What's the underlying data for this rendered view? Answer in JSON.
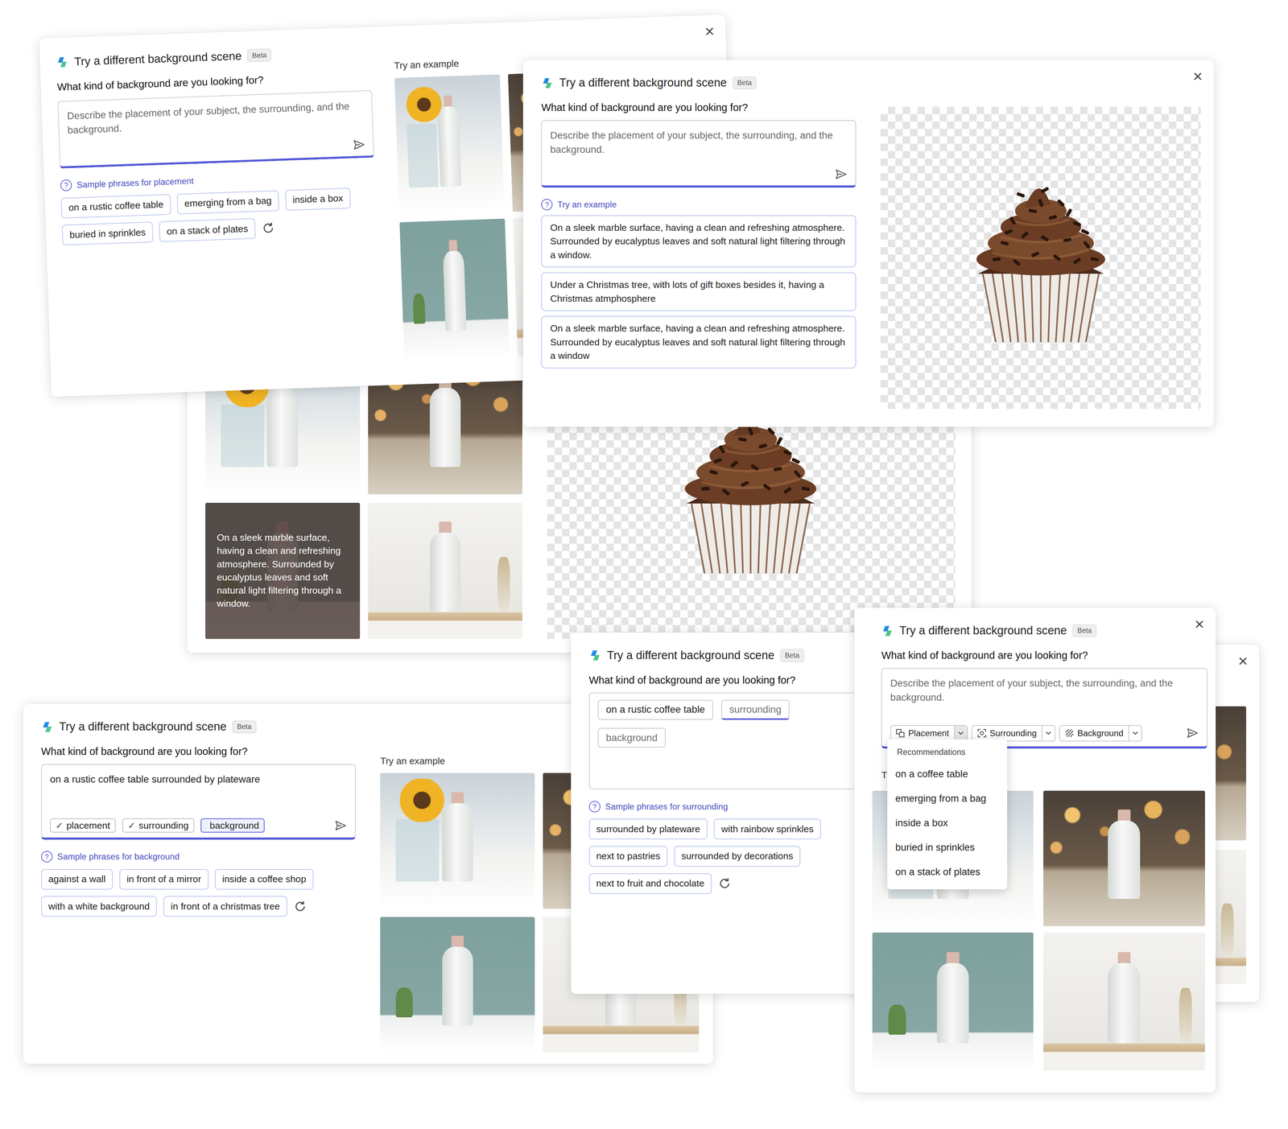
{
  "icons": {
    "close": "×",
    "help": "?",
    "check": "✓"
  },
  "placement_card": {
    "title": "Try a different background scene",
    "badge": "Beta",
    "question": "What kind of background are you looking for?",
    "placeholder": "Describe the placement of your subject, the surrounding, and the background.",
    "phrases_label": "Sample phrases for placement",
    "phrases": [
      "on a rustic coffee table",
      "emerging from a bag",
      "inside a box",
      "buried in sprinkles",
      "on a stack of plates"
    ],
    "examples_label": "Try an example"
  },
  "example_card": {
    "title": "Try a different background scene",
    "badge": "Beta",
    "question": "What kind of background are you looking for?",
    "placeholder": "Describe the placement of your subject, the surrounding, and the background.",
    "examples_label": "Try an example",
    "examples": [
      "On a sleek marble surface, having a clean and refreshing atmosphere. Surrounded by eucalyptus leaves and soft natural light filtering through a window.",
      "Under a Christmas tree, with lots of gift boxes besides it, having a Christmas atmphosphere",
      "On a sleek marble surface, having a clean and refreshing atmosphere. Surrounded by eucalyptus leaves and soft natural light filtering through a window"
    ]
  },
  "gallery_card": {
    "overlay": "On a sleek marble surface, having a clean and refreshing atmosphere. Surrounded by eucalyptus leaves and soft natural light filtering through a window."
  },
  "background_card": {
    "title": "Try a different background scene",
    "badge": "Beta",
    "question": "What kind of background are you looking for?",
    "value": "on a rustic coffee table surrounded by plateware",
    "tags": [
      {
        "label": "placement",
        "checked": true,
        "selected": false
      },
      {
        "label": "surrounding",
        "checked": true,
        "selected": false
      },
      {
        "label": "background",
        "checked": false,
        "selected": true
      }
    ],
    "phrases_label": "Sample phrases for background",
    "phrases": [
      "against a wall",
      "in front of a mirror",
      "inside a coffee shop",
      "with a white background",
      "in front of a christmas tree"
    ],
    "examples_label": "Try an example"
  },
  "surrounding_card": {
    "title": "Try a different background scene",
    "badge": "Beta",
    "question": "What kind of background are you looking for?",
    "slots": [
      {
        "label": "on a rustic coffee table",
        "kind": "filled",
        "selected": false
      },
      {
        "label": "surrounding",
        "kind": "empty",
        "selected": true
      },
      {
        "label": "background",
        "kind": "empty",
        "selected": false
      }
    ],
    "phrases_label": "Sample phrases for surrounding",
    "phrases": [
      "surrounded by plateware",
      "with rainbow sprinkles",
      "next to pastries",
      "surrounded by decorations",
      "next to fruit and chocolate"
    ]
  },
  "toolbar_card": {
    "title": "Try a different background scene",
    "badge": "Beta",
    "question": "What kind of background are you looking for?",
    "placeholder": "Describe the placement of your subject, the surrounding, and the background.",
    "tools": [
      {
        "label": "Placement",
        "expanded": true
      },
      {
        "label": "Surrounding",
        "expanded": false
      },
      {
        "label": "Background",
        "expanded": false
      }
    ],
    "menu": {
      "heading": "Recommendations",
      "items": [
        "on a coffee table",
        "emerging from a bag",
        "inside a box",
        "buried in sprinkles",
        "on a stack of plates"
      ]
    },
    "examples_label": "Tr"
  }
}
